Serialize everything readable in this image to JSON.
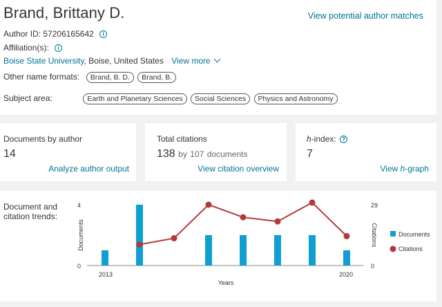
{
  "profile": {
    "name": "Brand, Brittany D.",
    "view_potential": "View potential author matches",
    "author_id_label": "Author ID:",
    "author_id": "57206165642",
    "affiliation_label": "Affiliation(s):",
    "affiliation_link": "Boise State University",
    "affiliation_rest": ", Boise, United States",
    "view_more": "View more",
    "other_names_label": "Other name formats:",
    "other_names": [
      "Brand, B. D.",
      "Brand, B."
    ],
    "subject_label": "Subject area:",
    "subjects": [
      "Earth and Planetary Sciences",
      "Social Sciences",
      "Physics and Astronomy"
    ]
  },
  "metrics": {
    "documents": {
      "label": "Documents by author",
      "value": "14",
      "link": "Analyze author output"
    },
    "citations": {
      "label": "Total citations",
      "value": "138",
      "by": "by",
      "docs_count": "107",
      "docs_word": "documents",
      "link": "View citation overview"
    },
    "hindex": {
      "label_italic": "h",
      "label_rest": "-index:",
      "value": "7",
      "link_pre": "View ",
      "link_italic": "h",
      "link_post": "-graph"
    }
  },
  "trends": {
    "label_line1": "Document and",
    "label_line2": "citation trends:"
  },
  "chart_data": {
    "type": "bar",
    "x": [
      2013,
      2014,
      2015,
      2016,
      2017,
      2018,
      2019,
      2020
    ],
    "series": [
      {
        "name": "Documents",
        "axis": "left",
        "kind": "bar",
        "values": [
          1,
          4,
          0,
          2,
          2,
          2,
          2,
          1
        ]
      },
      {
        "name": "Citations",
        "axis": "right",
        "kind": "line",
        "values": [
          null,
          10,
          13,
          29,
          23,
          21,
          30,
          14
        ]
      }
    ],
    "xlabel": "Years",
    "ylabel_left": "Documents",
    "ylabel_right": "Citations",
    "ylim_left": [
      0,
      4
    ],
    "ylim_right": [
      0,
      29
    ],
    "ytick_left": [
      "0",
      "4"
    ],
    "ytick_right": [
      "0",
      "29"
    ],
    "xtick_labels": [
      "2013",
      "2020"
    ],
    "legend_position": "right",
    "colors": {
      "bar": "#0f9fd3",
      "line": "#b23a3a"
    }
  }
}
